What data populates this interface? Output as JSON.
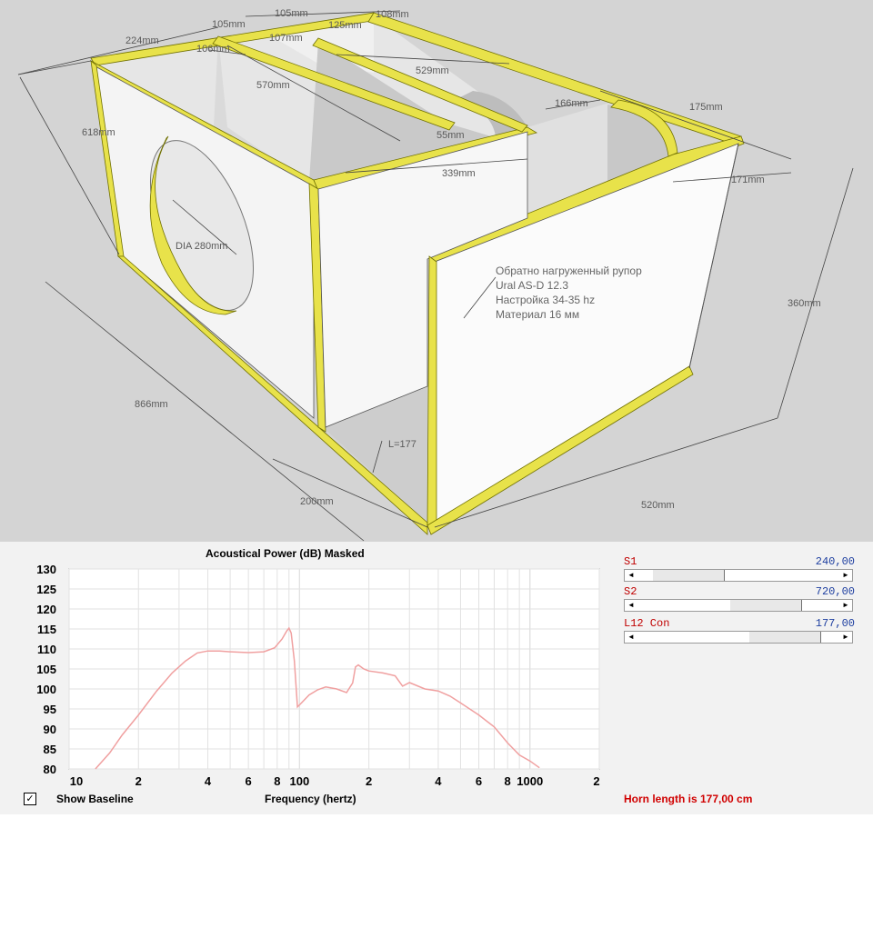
{
  "drawing": {
    "dimensions": {
      "d224": "224mm",
      "d105": "105mm",
      "d105b": "105mm",
      "d125": "125mm",
      "d108": "108mm",
      "d106": "106mm",
      "d107": "107mm",
      "d529": "529mm",
      "d570": "570mm",
      "d618": "618mm",
      "d166": "166mm",
      "d175": "175mm",
      "d55": "55mm",
      "d339": "339mm",
      "d171": "171mm",
      "dia": "DIA 280mm",
      "d360": "360mm",
      "d866": "866mm",
      "dL": "L=177",
      "d200": "200mm",
      "d520": "520mm"
    },
    "note": [
      "Обратно нагруженный рупор",
      "Ural AS-D 12.3",
      "Настройка 34-35 hz",
      "Материал 16 мм"
    ]
  },
  "simulator": {
    "chart_title": "Acoustical Power (dB)    Masked",
    "show_baseline_label": "Show Baseline",
    "show_baseline_checked": true,
    "horn_length_label": "Horn length is 177,00 cm",
    "sliders": [
      {
        "name": "S1",
        "value": "240,00",
        "position": 0.11
      },
      {
        "name": "S2",
        "value": "720,00",
        "position": 0.71
      },
      {
        "name": "L12 Con",
        "value": "177,00",
        "position": 0.86
      }
    ]
  },
  "chart_data": {
    "type": "line",
    "title": "Acoustical Power (dB)    Masked",
    "xlabel": "Frequency (hertz)",
    "ylabel": "",
    "x_scale": "log",
    "xlim": [
      10,
      2000
    ],
    "ylim": [
      80,
      130
    ],
    "x_tick_labels": [
      "10",
      "2",
      "4",
      "6",
      "8",
      "100",
      "2",
      "4",
      "6",
      "8",
      "1000",
      "2"
    ],
    "y_tick_labels": [
      "130",
      "125",
      "120",
      "115",
      "110",
      "105",
      "100",
      "95",
      "90",
      "85",
      "80"
    ],
    "grid": true,
    "series": [
      {
        "color": "#f0a0a0",
        "x": [
          13,
          15,
          17,
          20,
          24,
          28,
          32,
          36,
          40,
          45,
          50,
          60,
          70,
          78,
          84,
          88,
          90,
          92,
          95,
          98,
          102,
          110,
          120,
          130,
          145,
          160,
          170,
          175,
          180,
          190,
          200,
          230,
          260,
          280,
          300,
          350,
          400,
          450,
          500,
          600,
          700,
          800,
          900,
          1000,
          1100
        ],
        "y": [
          80,
          84,
          88.5,
          93.5,
          99.5,
          104,
          107,
          109,
          109.5,
          109.5,
          109.3,
          109.1,
          109.3,
          110.3,
          112.5,
          114.5,
          115.2,
          114,
          107,
          95.5,
          96.5,
          98.5,
          99.8,
          100.5,
          100,
          99.1,
          101.5,
          105.5,
          106,
          105,
          104.5,
          104,
          103.3,
          100.7,
          101.6,
          100,
          99.5,
          98.2,
          96.5,
          93.5,
          90.5,
          86.5,
          83.5,
          82,
          80.3
        ]
      }
    ]
  }
}
